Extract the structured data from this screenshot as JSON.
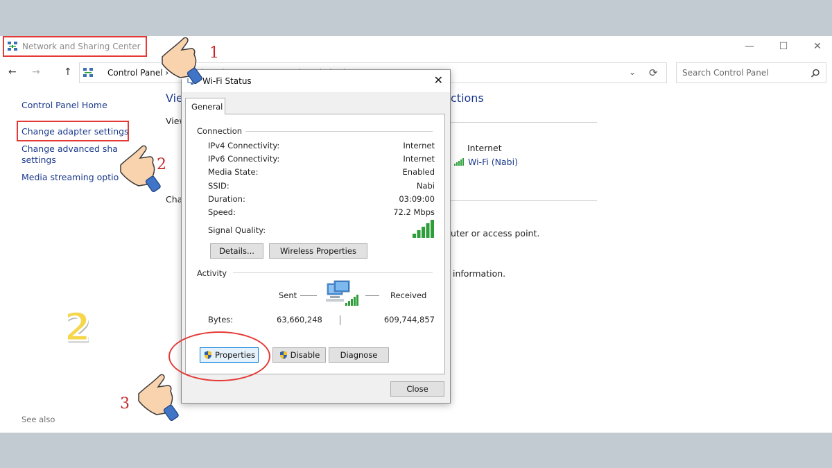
{
  "window": {
    "title": "Network and Sharing Center",
    "minimize_icon": "minimize-icon",
    "maximize_icon": "maximize-icon",
    "close_icon": "close-icon"
  },
  "nav": {
    "back": "←",
    "forward": "→",
    "up": "↑",
    "address": "Control Panel  ›  Network and Internet  ›  Network and Sharing Center",
    "dropdown": "⌄",
    "refresh": "⟳"
  },
  "search": {
    "placeholder": "Search Control Panel"
  },
  "sidebar": {
    "home": "Control Panel Home",
    "adapter": "Change adapter settings",
    "advanced_line1": "Change advanced sha",
    "advanced_line2": "settings",
    "media": "Media streaming optio",
    "see_also": "See also"
  },
  "background": {
    "heading_partial": "Vie",
    "heading_right": "ctions",
    "view_partial": "View",
    "change_partial": "Cha",
    "internet_label": "Internet",
    "wifi_link": "Wi-Fi (Nabi)",
    "router_text": "uter or access point.",
    "info_text": "information."
  },
  "dialog": {
    "title": "Wi-Fi Status",
    "tab": "General",
    "connection": {
      "title": "Connection",
      "rows": [
        {
          "label": "IPv4 Connectivity:",
          "value": "Internet"
        },
        {
          "label": "IPv6 Connectivity:",
          "value": "Internet"
        },
        {
          "label": "Media State:",
          "value": "Enabled"
        },
        {
          "label": "SSID:",
          "value": "Nabi"
        },
        {
          "label": "Duration:",
          "value": "03:09:00"
        },
        {
          "label": "Speed:",
          "value": "72.2 Mbps"
        }
      ],
      "signal_label": "Signal Quality:",
      "signal_bars": 5
    },
    "buttons": {
      "details": "Details...",
      "wireless": "Wireless Properties",
      "properties": "Properties",
      "disable": "Disable",
      "diagnose": "Diagnose",
      "close": "Close"
    },
    "activity": {
      "title": "Activity",
      "sent": "Sent",
      "received": "Received",
      "bytes_label": "Bytes:",
      "bytes_sent": "63,660,248",
      "bytes_received": "609,744,857"
    }
  },
  "annotations": {
    "step1": "1",
    "step2": "2",
    "step3": "3",
    "big_step": "2"
  },
  "colors": {
    "highlight_red": "#e53935",
    "link_blue": "#1b3a8c",
    "signal_green": "#2e9e3a"
  }
}
